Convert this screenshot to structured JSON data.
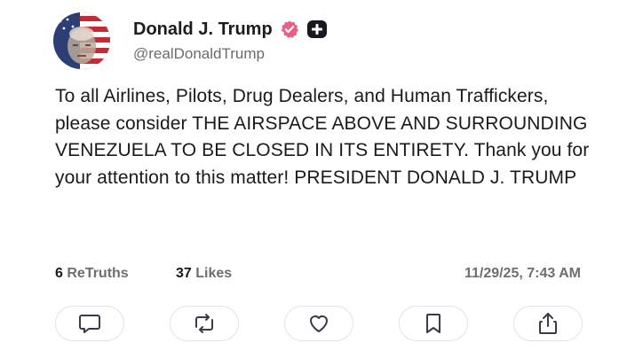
{
  "post": {
    "author": {
      "display_name": "Donald J. Trump",
      "handle": "@realDonaldTrump",
      "verified_badge_icon": "verified-badge-icon",
      "plus_badge_icon": "plus-badge-icon",
      "badge_color": "#ef5d82"
    },
    "text": "To all Airlines, Pilots, Drug Dealers, and Human Traffickers, please consider THE AIRSPACE ABOVE AND SURROUNDING VENEZUELA TO BE CLOSED IN ITS ENTIRETY. Thank you for your attention to this matter! PRESIDENT DONALD J. TRUMP",
    "stats": {
      "retruths_count": "6",
      "retruths_label": "ReTruths",
      "likes_count": "37",
      "likes_label": "Likes",
      "timestamp": "11/29/25, 7:43 AM"
    },
    "actions": [
      {
        "name": "reply",
        "icon": "comment-icon"
      },
      {
        "name": "retruth",
        "icon": "repost-icon"
      },
      {
        "name": "like",
        "icon": "heart-icon"
      },
      {
        "name": "bookmark",
        "icon": "bookmark-icon"
      },
      {
        "name": "share",
        "icon": "share-icon"
      }
    ]
  }
}
